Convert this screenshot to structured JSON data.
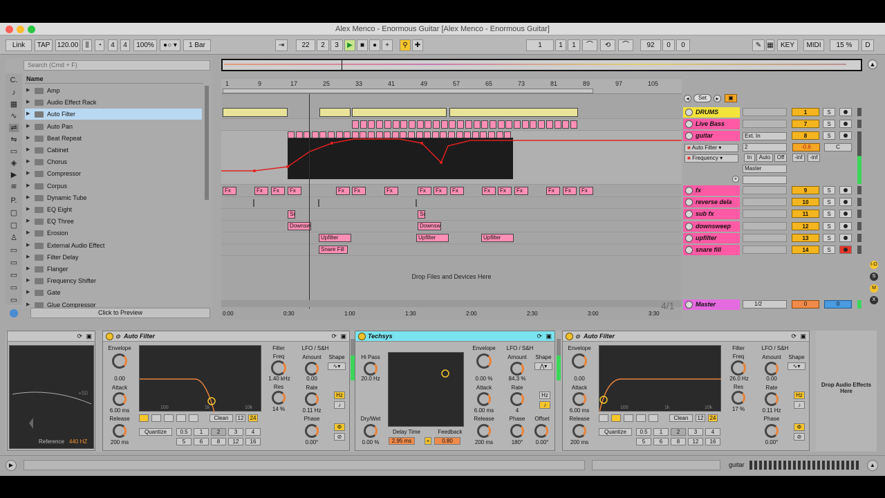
{
  "window": {
    "title": "Alex Menco - Enormous Guitar  [Alex Menco - Enormous Guitar]"
  },
  "control_bar": {
    "link": "Link",
    "tap": "TAP",
    "tempo": "120.00",
    "meter_num": "4",
    "meter_den": "4",
    "zoom": "100%",
    "quantize": "1 Bar",
    "position": [
      "22",
      "2",
      "3"
    ],
    "loop_start": [
      "1",
      "1",
      "1"
    ],
    "loop_length": [
      "92",
      "0",
      "0"
    ],
    "key": "KEY",
    "midi": "MIDI",
    "cpu": "15 %",
    "disk": "D"
  },
  "browser": {
    "search_placeholder": "Search (Cmd + F)",
    "column_header": "Name",
    "items": [
      "Amp",
      "Audio Effect Rack",
      "Auto Filter",
      "Auto Pan",
      "Beat Repeat",
      "Cabinet",
      "Chorus",
      "Compressor",
      "Corpus",
      "Dynamic Tube",
      "EQ Eight",
      "EQ Three",
      "Erosion",
      "External Audio Effect",
      "Filter Delay",
      "Flanger",
      "Frequency Shifter",
      "Gate",
      "Glue Compressor"
    ],
    "selected_index": 2,
    "preview_label": "Click to Preview"
  },
  "arrangement": {
    "ruler_bars": [
      "1",
      "9",
      "17",
      "25",
      "33",
      "41",
      "49",
      "57",
      "65",
      "73",
      "81",
      "89",
      "97",
      "105"
    ],
    "time_labels": [
      "0:00",
      "0:30",
      "1:00",
      "1:30",
      "2:00",
      "2:30",
      "3:00",
      "3:30"
    ],
    "drop_hint": "Drop Files and Devices Here",
    "loop_ratio": "4/1",
    "clips": {
      "fx": "Fx",
      "sub": "Su",
      "downsweep": "Downsw",
      "upfilter": "Upfilter",
      "snare": "Snare Fill"
    },
    "set_label": "Set"
  },
  "tracks": [
    {
      "name": "DRUMS",
      "num": "1",
      "color": "#f3e33a"
    },
    {
      "name": "Live Bass",
      "num": "7",
      "color": "#ff5aa5"
    },
    {
      "name": "guitar",
      "num": "8",
      "color": "#ff5aa5"
    },
    {
      "name": "fx",
      "num": "9",
      "color": "#ff5aa5"
    },
    {
      "name": "reverse dela",
      "num": "10",
      "color": "#ff5aa5"
    },
    {
      "name": "sub fx",
      "num": "11",
      "color": "#ff5aa5"
    },
    {
      "name": "downsweep",
      "num": "12",
      "color": "#ff5aa5"
    },
    {
      "name": "upfilter",
      "num": "13",
      "color": "#ff5aa5"
    },
    {
      "name": "snare fill",
      "num": "14",
      "color": "#ff5aa5"
    }
  ],
  "guitar_track": {
    "input": "Ext. In",
    "channel": "2",
    "device": "Auto Filter",
    "param": "Frequency",
    "monitor": [
      "In",
      "Auto",
      "Off"
    ],
    "output": "Master",
    "volume": "-0.6",
    "pan": "C",
    "send_a": "-inf",
    "send_b": "-inf"
  },
  "master": {
    "name": "Master",
    "cue": "1/2",
    "vol": "0",
    "pan": "0"
  },
  "devices": {
    "tuner": {
      "reference_label": "Reference",
      "reference_value": "440 HZ",
      "scale": "+50"
    },
    "auto_filter_1": {
      "title": "Auto Filter",
      "envelope": "Envelope",
      "env_amount": "0.00",
      "attack": "Attack",
      "attack_val": "6.00 ms",
      "release": "Release",
      "release_val": "200 ms",
      "filter": "Filter",
      "freq": "Freq",
      "freq_val": "1.40 kHz",
      "res": "Res",
      "res_val": "14 %",
      "lfo": "LFO / S&H",
      "amount": "Amount",
      "amount_val": "0.00",
      "shape": "Shape",
      "rate": "Rate",
      "rate_val": "0.11 Hz",
      "phase": "Phase",
      "phase_val": "0.00°",
      "hz": "Hz",
      "quantize": "Quantize",
      "clean": "Clean",
      "q_vals": [
        "0.5",
        "1",
        "2",
        "3",
        "4",
        "5",
        "6",
        "8",
        "12",
        "16"
      ],
      "slope": [
        "12",
        "24"
      ],
      "freq_axis": [
        "100",
        "1k",
        "10k"
      ]
    },
    "techsys": {
      "title": "Techsys",
      "hipass": "Hi Pass",
      "hipass_val": "20.0 Hz",
      "drywet": "Dry/Wet",
      "drywet_val": "0.00 %",
      "delay_time": "Delay Time",
      "delay_val": "2.95 ms",
      "feedback": "Feedback",
      "feedback_val": "0.80",
      "envelope": "Envelope",
      "env_val": "0.00 %",
      "attack": "Attack",
      "attack_val": "6.00 ms",
      "release": "Release",
      "release_val": "200 ms",
      "lfo": "LFO / S&H",
      "amount": "Amount",
      "amount_val": "84.3 %",
      "shape": "Shape",
      "rate": "Rate",
      "rate_val": "4",
      "hz": "Hz",
      "phase": "Phase",
      "phase_val": "180°",
      "offset": "Offset",
      "offset_val": "0.00°"
    },
    "auto_filter_2": {
      "title": "Auto Filter",
      "envelope": "Envelope",
      "env_amount": "0.00",
      "attack": "Attack",
      "attack_val": "6.00 ms",
      "release": "Release",
      "release_val": "200 ms",
      "filter": "Filter",
      "freq": "Freq",
      "freq_val": "26.0 Hz",
      "res": "Res",
      "res_val": "17 %",
      "lfo": "LFO / S&H",
      "amount": "Amount",
      "amount_val": "0.00",
      "shape": "Shape",
      "rate": "Rate",
      "rate_val": "0.11 Hz",
      "phase": "Phase",
      "phase_val": "0.00°",
      "hz": "Hz",
      "quantize": "Quantize",
      "clean": "Clean",
      "q_vals": [
        "0.5",
        "1",
        "2",
        "3",
        "4",
        "5",
        "6",
        "8",
        "12",
        "16"
      ],
      "slope": [
        "12",
        "24"
      ],
      "freq_axis": [
        "100",
        "1k",
        "10k"
      ]
    },
    "drop_hint": "Drop Audio Effects Here"
  },
  "status": {
    "track_name": "guitar"
  }
}
